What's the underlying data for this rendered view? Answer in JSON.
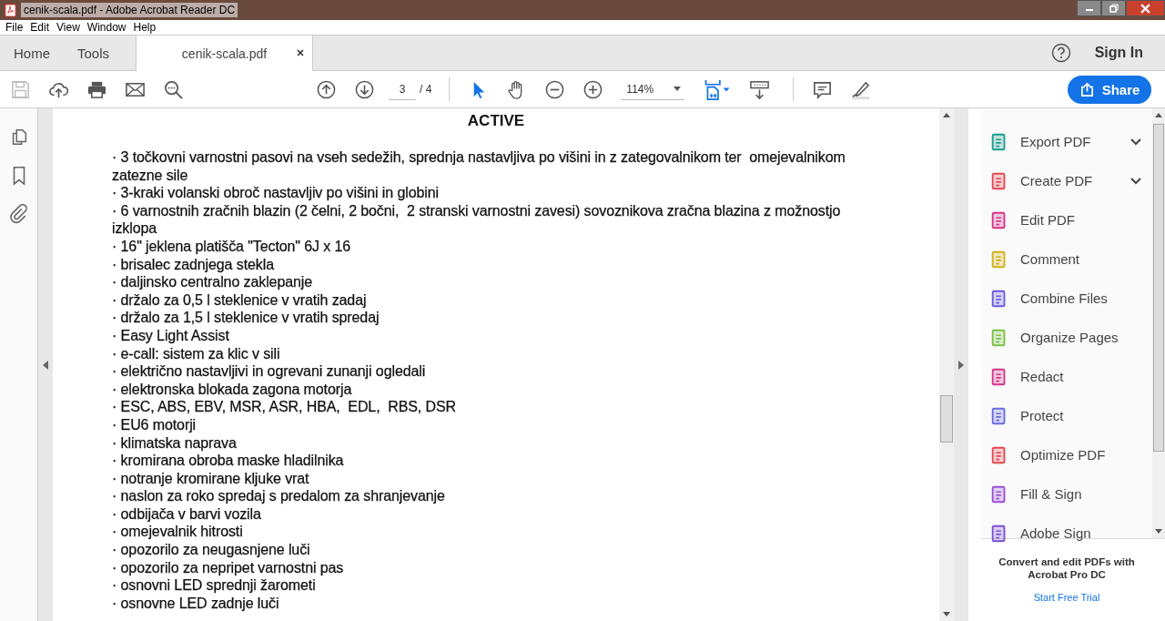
{
  "window": {
    "title": "cenik-scala.pdf - Adobe Acrobat Reader DC"
  },
  "menu": [
    "File",
    "Edit",
    "View",
    "Window",
    "Help"
  ],
  "tabs": [
    {
      "label": "Home",
      "selected": false
    },
    {
      "label": "Tools",
      "selected": false
    },
    {
      "label": "cenik-scala.pdf",
      "selected": true,
      "closable": true
    }
  ],
  "sign_in": "Sign In",
  "toolbar": {
    "page": "3",
    "page_total": "/ 4",
    "zoom": "114%",
    "share": "Share"
  },
  "document": {
    "heading": "ACTIVE",
    "items": [
      "· 3 točkovni varnostni pasovi na vseh sedežih, sprednja nastavljiva po višini in z zategovalnikom ter  omejevalnikom zatezne sile",
      "· 3-kraki volanski obroč nastavljiv po višini in globini",
      "· 6 varnostnih zračnih blazin (2 čelni, 2 bočni,  2 stranski varnostni zavesi) sovoznikova zračna blazina z možnostjo izklopa",
      "· 16\" jeklena platišča \"Tecton\" 6J x 16",
      "· brisalec zadnjega stekla",
      "· daljinsko centralno zaklepanje",
      "· držalo za 0,5 l steklenice v vratih zadaj",
      "· držalo za 1,5 l steklenice v vratih spredaj",
      "· Easy Light Assist",
      "· e-call: sistem za klic v sili",
      "· električno nastavljivi in ogrevani zunanji ogledali",
      "· elektronska blokada zagona motorja",
      "· ESC, ABS, EBV, MSR, ASR, HBA,  EDL,  RBS, DSR",
      "· EU6 motorji",
      "· klimatska naprava",
      "· kromirana obroba maske hladilnika",
      "· notranje kromirane kljuke vrat",
      "· naslon za roko spredaj s predalom za shranjevanje",
      "· odbijača v barvi vozila",
      "· omejevalnik hitrosti",
      "· opozorilo za neugasnjene luči",
      "· opozorilo za nepripet varnostni pas",
      "· osnovni LED sprednji žarometi",
      "· osnovne LED zadnje luči"
    ]
  },
  "tools": [
    {
      "label": "Export PDF",
      "dropdown": true
    },
    {
      "label": "Create PDF",
      "dropdown": true
    },
    {
      "label": "Edit PDF",
      "dropdown": false
    },
    {
      "label": "Comment",
      "dropdown": false
    },
    {
      "label": "Combine Files",
      "dropdown": false
    },
    {
      "label": "Organize Pages",
      "dropdown": false
    },
    {
      "label": "Redact",
      "dropdown": false
    },
    {
      "label": "Protect",
      "dropdown": false
    },
    {
      "label": "Optimize PDF",
      "dropdown": false
    },
    {
      "label": "Fill & Sign",
      "dropdown": false
    },
    {
      "label": "Adobe Sign",
      "dropdown": false
    }
  ],
  "promo": {
    "text": "Convert and edit PDFs with Acrobat Pro DC",
    "link": "Start Free Trial"
  }
}
